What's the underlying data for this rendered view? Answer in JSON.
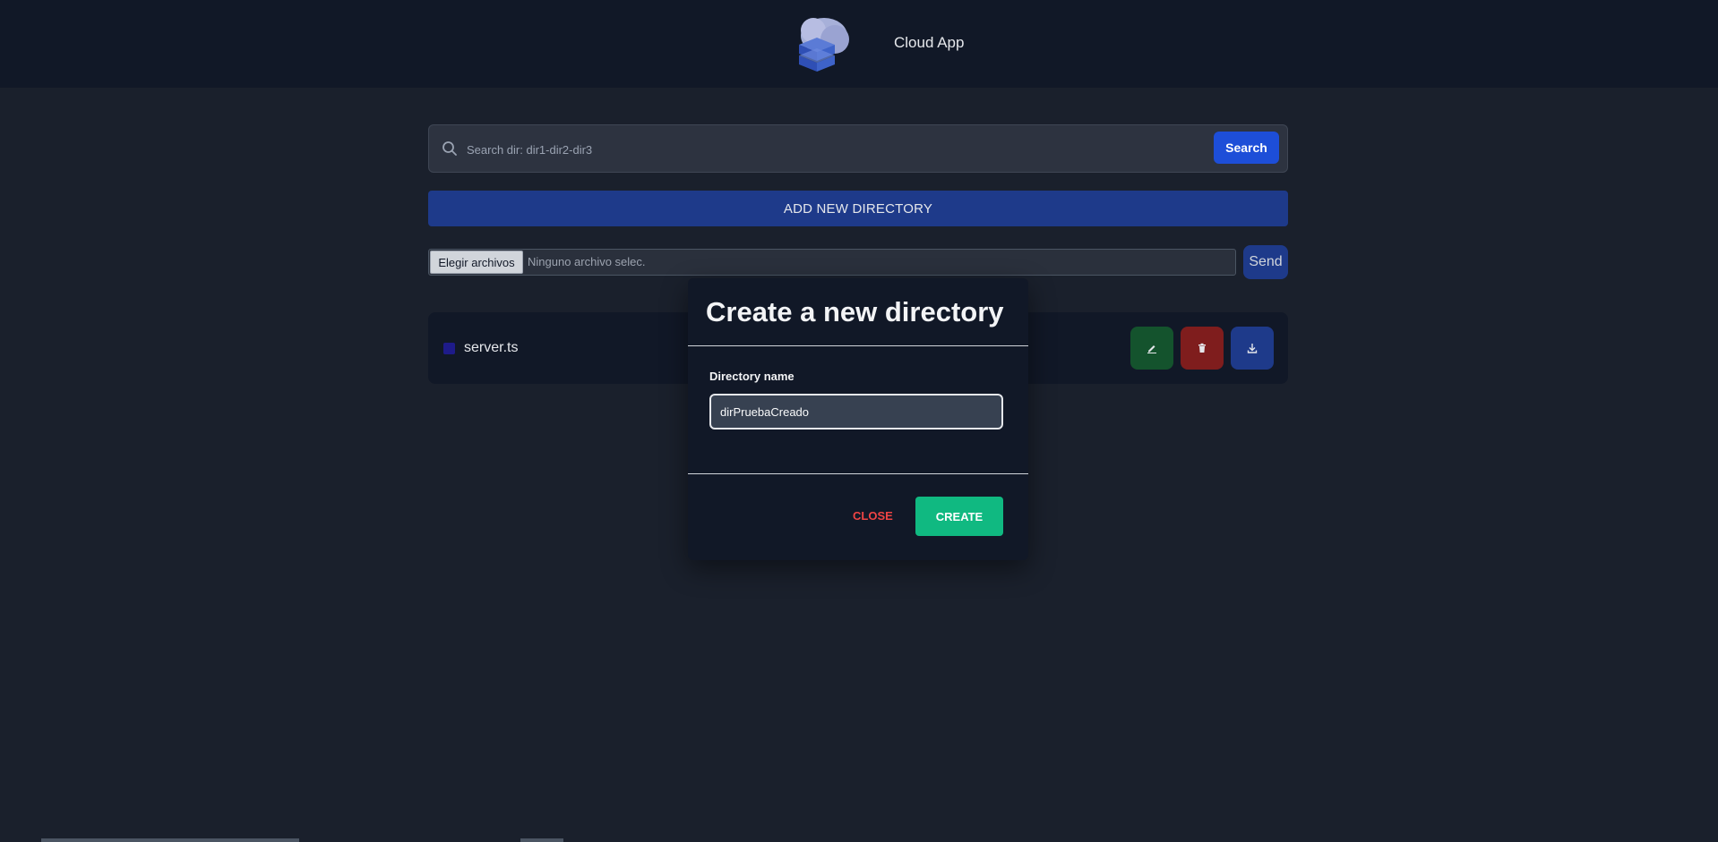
{
  "header": {
    "app_title": "Cloud App",
    "logo_icon": "cloud-server-icon"
  },
  "search": {
    "placeholder": "Search dir: dir1-dir2-dir3",
    "button_label": "Search",
    "icon": "search-icon"
  },
  "add_directory": {
    "label": "ADD NEW DIRECTORY"
  },
  "upload": {
    "choose_label": "Elegir archivos",
    "status": "Ninguno archivo selec.",
    "send_label": "Send"
  },
  "files": [
    {
      "name": "server.ts",
      "actions": [
        "edit-icon",
        "trash-icon",
        "download-icon"
      ]
    }
  ],
  "modal": {
    "title": "Create a new directory",
    "field_label": "Directory name",
    "field_value": "dirPruebaCreado",
    "close_label": "CLOSE",
    "create_label": "CREATE"
  },
  "colors": {
    "background": "#1a202c",
    "header": "#111827",
    "primary": "#1e3a8a",
    "success": "#10b981",
    "danger": "#ef4444"
  }
}
